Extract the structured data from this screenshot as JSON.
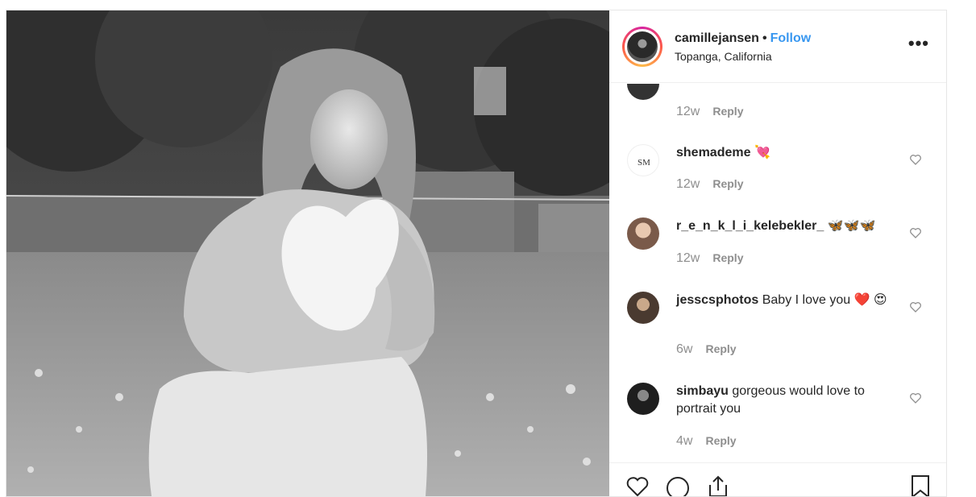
{
  "header": {
    "username": "camillejansen",
    "separator": "•",
    "follow_label": "Follow",
    "location": "Topanga, California",
    "more_icon": "•••"
  },
  "comments": [
    {
      "username": "",
      "text": "",
      "age": "12w",
      "reply_label": "Reply"
    },
    {
      "username": "shemademe",
      "text": "💘",
      "age": "12w",
      "reply_label": "Reply"
    },
    {
      "username": "r_e_n_k_l_i_kelebekler_",
      "text": "🦋🦋🦋",
      "age": "12w",
      "reply_label": "Reply"
    },
    {
      "username": "jesscsphotos",
      "text": "Baby I love you ❤️ 😍",
      "age": "6w",
      "reply_label": "Reply"
    },
    {
      "username": "simbayu",
      "text": "gorgeous would love to portrait you",
      "age": "4w",
      "reply_label": "Reply"
    }
  ],
  "icons": {
    "like": "heart-icon",
    "comment": "comment-icon",
    "share": "share-icon",
    "save": "bookmark-icon",
    "comment_like": "heart-icon"
  },
  "colors": {
    "follow": "#3897f0",
    "text": "#262626",
    "muted": "#8e8e8e",
    "border": "#efefef"
  }
}
